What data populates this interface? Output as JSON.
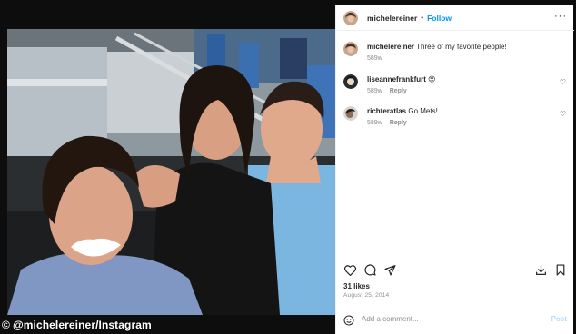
{
  "photo": {
    "credit": "@michelereiner/Instagram",
    "credit_symbol": "©"
  },
  "header": {
    "username": "michelereiner",
    "separator": "•",
    "follow_label": "Follow",
    "more_label": "···"
  },
  "caption": {
    "username": "michelereiner",
    "text": "Three of my favorite people!",
    "time": "589w"
  },
  "comments": [
    {
      "username": "liseannefrankfurt",
      "text": "😍",
      "time": "589w",
      "reply_label": "Reply"
    },
    {
      "username": "richteratlas",
      "text": "Go Mets!",
      "time": "589w",
      "reply_label": "Reply"
    }
  ],
  "actions": {
    "icons": [
      "heart-icon",
      "comment-icon",
      "share-icon",
      "download-icon",
      "bookmark-icon"
    ]
  },
  "likes": "31 likes",
  "date": "August 25, 2014",
  "add_comment": {
    "placeholder": "Add a comment...",
    "post_label": "Post"
  },
  "colors": {
    "follow": "#0095f6",
    "post_disabled": "#b2dffc",
    "muted": "#8e8e8e",
    "text": "#262626"
  }
}
